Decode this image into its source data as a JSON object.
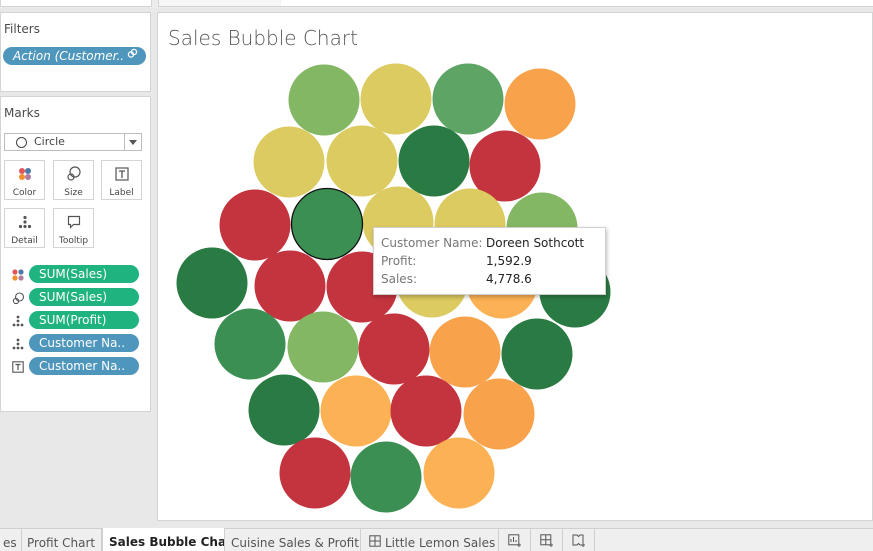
{
  "filters": {
    "title": "Filters",
    "pill": "Action (Customer..",
    "pill_icon": "link-icon"
  },
  "marks": {
    "title": "Marks",
    "mark_type": "Circle",
    "buttons": [
      "Color",
      "Size",
      "Label",
      "Detail",
      "Tooltip"
    ],
    "shelf": [
      {
        "icon": "color-icon",
        "label": "SUM(Sales)",
        "kind": "measure"
      },
      {
        "icon": "size-icon",
        "label": "SUM(Sales)",
        "kind": "measure"
      },
      {
        "icon": "detail-icon",
        "label": "SUM(Profit)",
        "kind": "measure"
      },
      {
        "icon": "detail-icon",
        "label": "Customer Na..",
        "kind": "dimension"
      },
      {
        "icon": "label-icon",
        "label": "Customer Na..",
        "kind": "dimension"
      }
    ]
  },
  "view": {
    "title": "Sales Bubble Chart"
  },
  "chart_data": {
    "type": "scatter",
    "title": "Sales Bubble Chart",
    "encoding": "packed bubbles, circle color by SUM(Profit): red (low) to green (high)",
    "highlighted": "Doreen Sothcott",
    "colors": {
      "dark_red": "#c3343f",
      "orange": "#f8a24c",
      "light_orange": "#fbb154",
      "yellow": "#dccb60",
      "light_green": "#83b763",
      "mid_green": "#5ea565",
      "green": "#3b8f52",
      "dark_green": "#2a7a43"
    },
    "bubbles": [
      {
        "color": "light_green"
      },
      {
        "color": "yellow"
      },
      {
        "color": "mid_green"
      },
      {
        "color": "orange"
      },
      {
        "color": "yellow"
      },
      {
        "color": "yellow"
      },
      {
        "color": "dark_green"
      },
      {
        "color": "dark_red"
      },
      {
        "color": "dark_red"
      },
      {
        "color": "yellow"
      },
      {
        "color": "yellow"
      },
      {
        "color": "light_green"
      },
      {
        "color": "green",
        "highlighted": true
      },
      {
        "color": "dark_green"
      },
      {
        "color": "dark_red"
      },
      {
        "color": "dark_red"
      },
      {
        "color": "yellow"
      },
      {
        "color": "light_orange"
      },
      {
        "color": "dark_green"
      },
      {
        "color": "green"
      },
      {
        "color": "light_green"
      },
      {
        "color": "dark_red"
      },
      {
        "color": "orange"
      },
      {
        "color": "dark_green"
      },
      {
        "color": "dark_green"
      },
      {
        "color": "light_orange"
      },
      {
        "color": "dark_red"
      },
      {
        "color": "orange"
      },
      {
        "color": "dark_red"
      },
      {
        "color": "green"
      },
      {
        "color": "light_orange"
      }
    ]
  },
  "tooltip": {
    "rows": [
      {
        "key": "Customer Name:",
        "value": "Doreen Sothcott"
      },
      {
        "key": "Profit:",
        "value": "1,592.9"
      },
      {
        "key": "Sales:",
        "value": "4,778.6"
      }
    ]
  },
  "tabs": [
    {
      "label": "es",
      "icon": "",
      "active": false
    },
    {
      "label": "Profit Chart",
      "icon": "",
      "active": false
    },
    {
      "label": "Sales Bubble Chart",
      "icon": "",
      "active": true
    },
    {
      "label": "Cuisine Sales & Profit",
      "icon": "",
      "active": false
    },
    {
      "label": "Little Lemon Sales",
      "icon": "dashboard-icon",
      "active": false
    }
  ],
  "new_tab_buttons": [
    "new-worksheet-icon",
    "new-dashboard-icon",
    "new-story-icon"
  ]
}
